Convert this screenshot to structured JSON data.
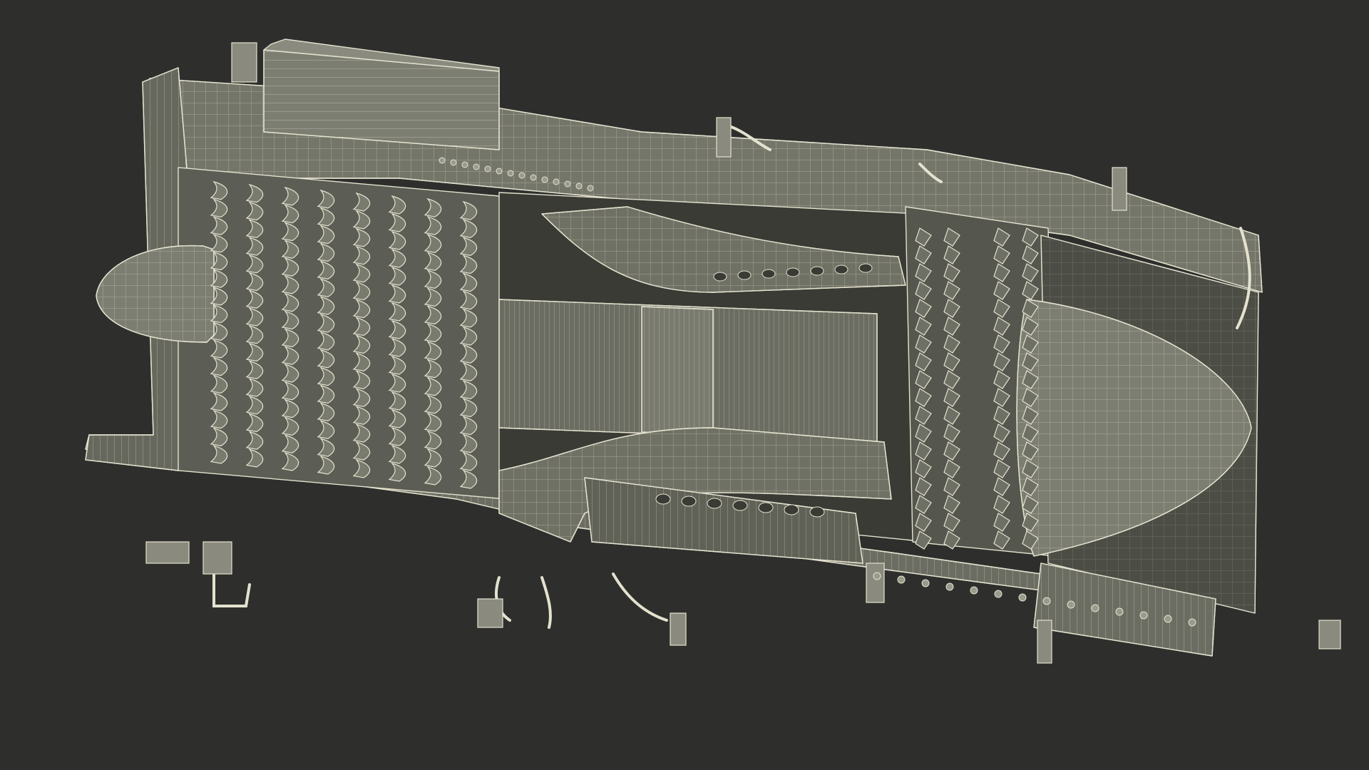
{
  "scene": {
    "subject": "jet-engine-cutaway-wireframe",
    "colors": {
      "background": "#2e2f2d",
      "body_fill": "#6c6d62",
      "body_fill_dark": "#4c4d45",
      "body_fill_light": "#7d7e72",
      "cavity": "#3a3b35",
      "wire": "#e4e2cf",
      "wire_dim": "#b9b8a6"
    }
  }
}
